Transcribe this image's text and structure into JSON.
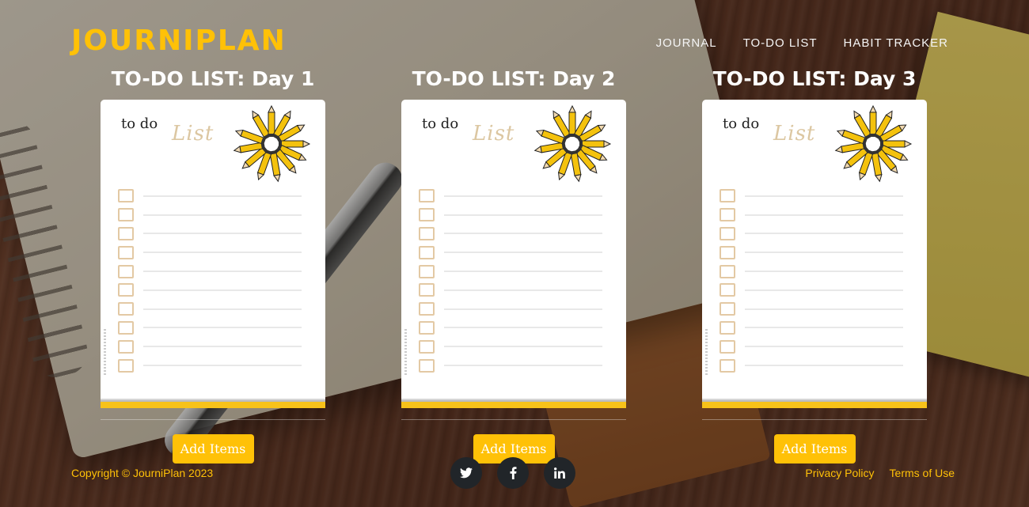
{
  "brand": "JOURNIPLAN",
  "nav": [
    "JOURNAL",
    "TO-DO LIST",
    "HABIT TRACKER"
  ],
  "cards": [
    {
      "title": "TO-DO LIST: Day 1",
      "paper_todo": "to do",
      "paper_list": "List",
      "button": "Add Items"
    },
    {
      "title": "TO-DO LIST: Day 2",
      "paper_todo": "to do",
      "paper_list": "List",
      "button": "Add Items"
    },
    {
      "title": "TO-DO LIST: Day 3",
      "paper_todo": "to do",
      "paper_list": "List",
      "button": "Add Items"
    }
  ],
  "footer": {
    "copyright": "Copyright © JourniPlan 2023",
    "social": [
      "twitter-icon",
      "facebook-icon",
      "linkedin-icon"
    ],
    "links": [
      "Privacy Policy",
      "Terms of Use"
    ]
  },
  "colors": {
    "accent": "#ffc107",
    "social_bg": "#212529"
  }
}
